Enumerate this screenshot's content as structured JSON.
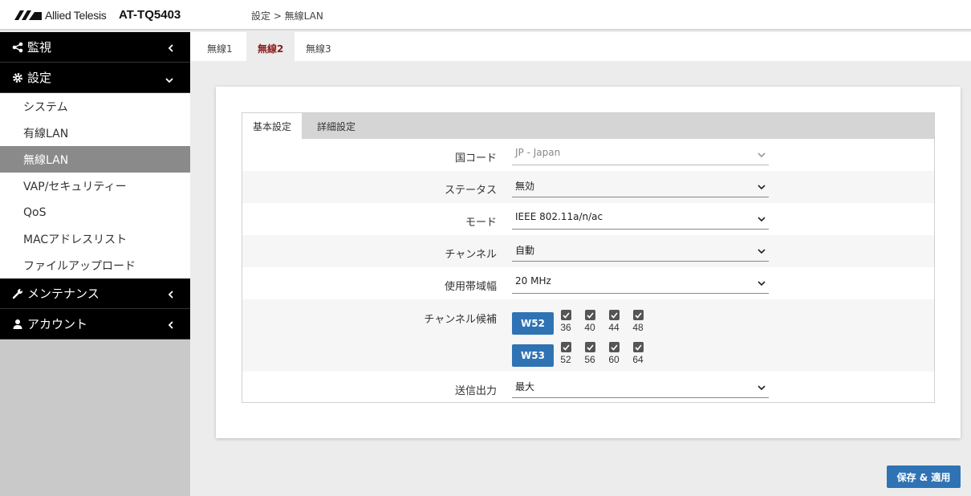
{
  "header": {
    "logo_text": "Allied Telesis",
    "model": "AT-TQ5403",
    "breadcrumb": "設定 > 無線LAN"
  },
  "sidebar": {
    "monitor": "監視",
    "settings": "設定",
    "items": [
      "システム",
      "有線LAN",
      "無線LAN",
      "VAP/セキュリティー",
      "QoS",
      "MACアドレスリスト",
      "ファイルアップロード"
    ],
    "maintenance": "メンテナンス",
    "account": "アカウント"
  },
  "radio_tabs": [
    "無線1",
    "無線2",
    "無線3"
  ],
  "sub_tabs": [
    "基本設定",
    "詳細設定"
  ],
  "form": {
    "country_label": "国コード",
    "country_value": "JP - Japan",
    "status_label": "ステータス",
    "status_value": "無効",
    "mode_label": "モード",
    "mode_value": "IEEE 802.11a/n/ac",
    "channel_label": "チャンネル",
    "channel_value": "自動",
    "bandwidth_label": "使用帯域幅",
    "bandwidth_value": "20 MHz",
    "candidates_label": "チャンネル候補",
    "w52_label": "W52",
    "w52_channels": [
      "36",
      "40",
      "44",
      "48"
    ],
    "w53_label": "W53",
    "w53_channels": [
      "52",
      "56",
      "60",
      "64"
    ],
    "power_label": "送信出力",
    "power_value": "最大"
  },
  "save_label": "保存 & 適用",
  "colors": {
    "accent": "#2f73b4",
    "active_tab": "#8b1b1b",
    "sidebar_bg": "#c9c9c9"
  }
}
